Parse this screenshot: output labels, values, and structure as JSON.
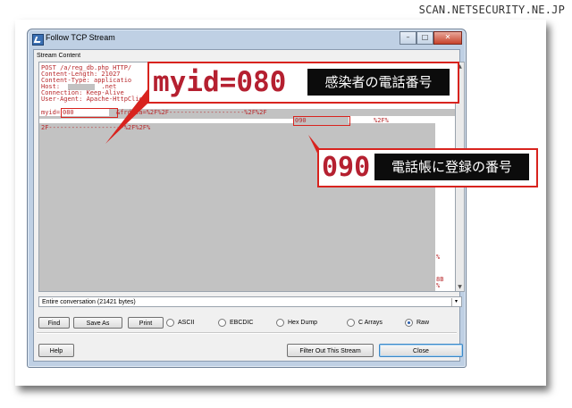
{
  "watermark": "SCAN.NETSECURITY.NE.JP",
  "window": {
    "title": "Follow TCP Stream",
    "controls": {
      "minimize": "–",
      "maximize": "□",
      "close": "✕"
    },
    "group_label": "Stream Content"
  },
  "stream": {
    "lines": [
      "POST /a/reg_db.php HTTP/",
      "Content-Length: 21027",
      "Content-Type: applicatio",
      "Host:           .net",
      "Connection: Keep-Alive",
      "User-Agent: Apache-HttpClient/UNAVAILABLE (java 1.4)"
    ],
    "row1_prefix": "myid=",
    "myid_value": "080",
    "row1_mid": "&frdata=%2F%2F--------------------%2F%2F",
    "row2_start": "2F--------------------%2F%2F%",
    "frd_value": "090",
    "frd_suffix": "%2F%",
    "right_edge_1": "%",
    "right_edge_2": "8B",
    "right_edge_3": "%"
  },
  "conversation_select": {
    "value": "Entire conversation (21421 bytes)",
    "arrow": "▾"
  },
  "buttons": {
    "find": "Find",
    "save_as": "Save As",
    "print": "Print",
    "help": "Help",
    "filter_out": "Filter Out This Stream",
    "close": "Close"
  },
  "radios": [
    {
      "label": "ASCII",
      "selected": false
    },
    {
      "label": "EBCDIC",
      "selected": false
    },
    {
      "label": "Hex Dump",
      "selected": false
    },
    {
      "label": "C Arrays",
      "selected": false
    },
    {
      "label": "Raw",
      "selected": true
    }
  ],
  "callouts": {
    "myid": {
      "code": "myid=080",
      "caption": "感染者の電話番号"
    },
    "phonebook": {
      "code": "090",
      "caption": "電話帳に登録の番号"
    }
  },
  "colors": {
    "highlight_red": "#d8231e",
    "stream_text": "#b8282b",
    "redacted_grey": "#c2c2c2"
  }
}
